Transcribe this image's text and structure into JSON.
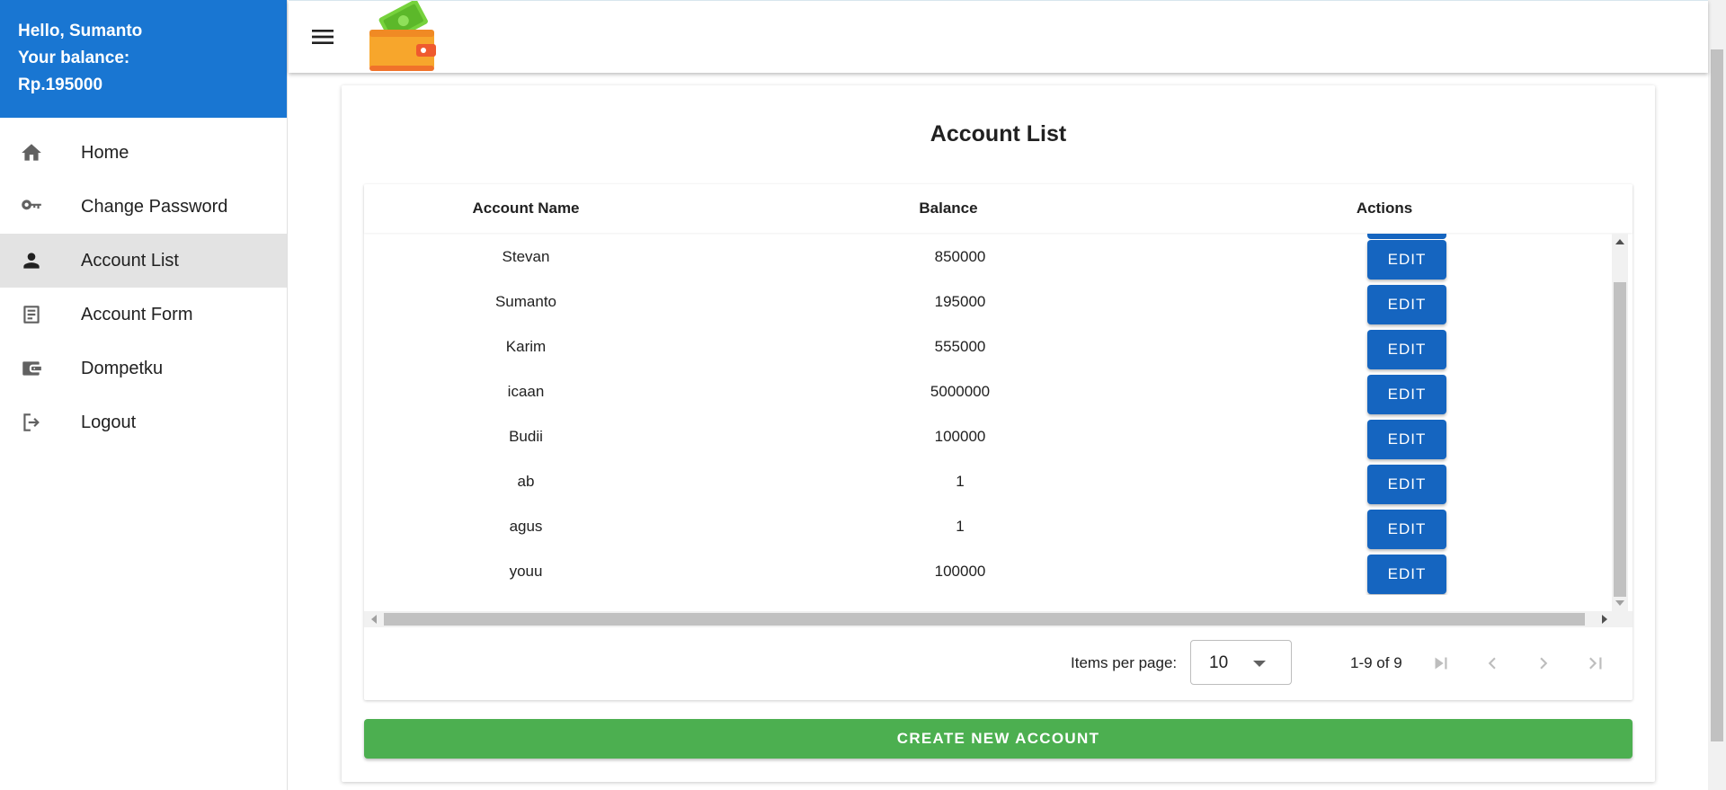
{
  "sidebar": {
    "greeting": "Hello, Sumanto",
    "balance_label": "Your balance:",
    "balance_value": "Rp.195000",
    "items": [
      {
        "label": "Home",
        "icon": "home-icon"
      },
      {
        "label": "Change Password",
        "icon": "key-icon"
      },
      {
        "label": "Account List",
        "icon": "person-icon",
        "active": true
      },
      {
        "label": "Account Form",
        "icon": "form-icon"
      },
      {
        "label": "Dompetku",
        "icon": "wallet-icon"
      },
      {
        "label": "Logout",
        "icon": "logout-icon"
      }
    ]
  },
  "topbar": {
    "menu_icon": "hamburger-menu-icon",
    "logo": "wallet-logo"
  },
  "page": {
    "title": "Account List"
  },
  "table": {
    "columns": [
      "Account Name",
      "Balance",
      "Actions"
    ],
    "edit_label": "EDIT",
    "rows": [
      {
        "name": "Stevan",
        "balance": "850000"
      },
      {
        "name": "Sumanto",
        "balance": "195000"
      },
      {
        "name": "Karim",
        "balance": "555000"
      },
      {
        "name": "icaan",
        "balance": "5000000"
      },
      {
        "name": "Budii",
        "balance": "100000"
      },
      {
        "name": "ab",
        "balance": "1"
      },
      {
        "name": "agus",
        "balance": "1"
      },
      {
        "name": "youu",
        "balance": "100000"
      }
    ]
  },
  "paginator": {
    "items_per_page_label": "Items per page:",
    "items_per_page_value": "10",
    "range_label": "1-9 of 9"
  },
  "actions": {
    "create_label": "CREATE NEW ACCOUNT"
  },
  "colors": {
    "header_blue": "#1976d2",
    "edit_blue": "#1565c0",
    "create_green": "#4caf50",
    "active_bg": "#e3e3e3"
  }
}
